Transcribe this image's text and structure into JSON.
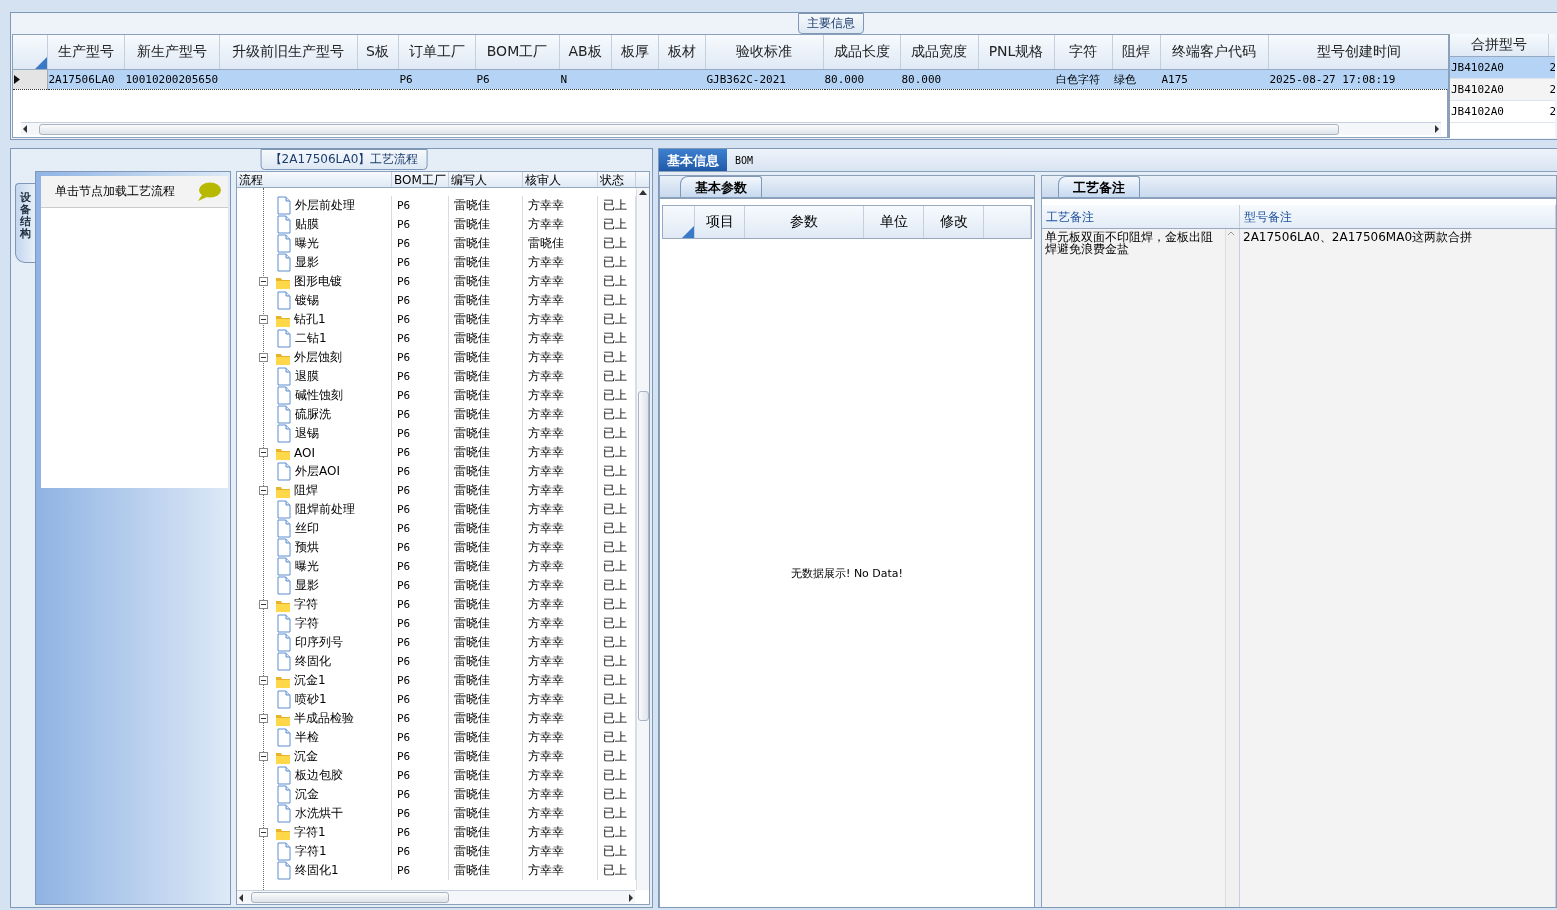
{
  "main_info": {
    "title": "主要信息",
    "columns": [
      "生产型号",
      "新生产型号",
      "升级前旧生产型号",
      "S板",
      "订单工厂",
      "BOM工厂",
      "AB板",
      "板厚",
      "板材",
      "验收标准",
      "成品长度",
      "成品宽度",
      "PNL规格",
      "字符",
      "阻焊",
      "终端客户代码",
      "型号创建时间"
    ],
    "rows": [
      {
        "selected": true,
        "cells": [
          "2A17506LA0",
          "10010200205650",
          null,
          null,
          "P6",
          "P6",
          "N",
          null,
          null,
          "GJB362C-2021",
          "80.000",
          "80.000",
          null,
          "白色字符",
          "绿色",
          "A175",
          "2025-08-27 17:08:19"
        ]
      }
    ]
  },
  "merge_models": {
    "columns": [
      "合拼型号"
    ],
    "rows": [
      {
        "selected": true,
        "cells": [
          "JB4102A0",
          "2"
        ]
      },
      {
        "selected": false,
        "cells": [
          "JB4102A0",
          "2"
        ]
      },
      {
        "selected": false,
        "cells": [
          "JB4102A0",
          "2"
        ]
      }
    ]
  },
  "flow": {
    "title": "【2A17506LA0】工艺流程",
    "side_tab": "设备结构",
    "hint": "单击节点加载工艺流程",
    "columns": [
      "流程",
      "BOM工厂",
      "编写人",
      "核审人",
      "状态"
    ],
    "items": [
      {
        "kind": "step",
        "name": "外层前处理",
        "bom": "P6",
        "author": "雷晓佳",
        "reviewer": "方幸幸",
        "status": "已上"
      },
      {
        "kind": "step",
        "name": "贴膜",
        "bom": "P6",
        "author": "雷晓佳",
        "reviewer": "方幸幸",
        "status": "已上"
      },
      {
        "kind": "step",
        "name": "曝光",
        "bom": "P6",
        "author": "雷晓佳",
        "reviewer": "雷晓佳",
        "status": "已上"
      },
      {
        "kind": "step",
        "name": "显影",
        "bom": "P6",
        "author": "雷晓佳",
        "reviewer": "方幸幸",
        "status": "已上"
      },
      {
        "kind": "group",
        "name": "图形电镀",
        "bom": "P6",
        "author": "雷晓佳",
        "reviewer": "方幸幸",
        "status": "已上",
        "expanded": true,
        "children": [
          {
            "kind": "step",
            "name": "镀锡",
            "bom": "P6",
            "author": "雷晓佳",
            "reviewer": "方幸幸",
            "status": "已上"
          }
        ]
      },
      {
        "kind": "group",
        "name": "钻孔1",
        "bom": "P6",
        "author": "雷晓佳",
        "reviewer": "方幸幸",
        "status": "已上",
        "expanded": true,
        "children": [
          {
            "kind": "step",
            "name": "二钻1",
            "bom": "P6",
            "author": "雷晓佳",
            "reviewer": "方幸幸",
            "status": "已上"
          }
        ]
      },
      {
        "kind": "group",
        "name": "外层蚀刻",
        "bom": "P6",
        "author": "雷晓佳",
        "reviewer": "方幸幸",
        "status": "已上",
        "expanded": true,
        "children": [
          {
            "kind": "step",
            "name": "退膜",
            "bom": "P6",
            "author": "雷晓佳",
            "reviewer": "方幸幸",
            "status": "已上"
          },
          {
            "kind": "step",
            "name": "碱性蚀刻",
            "bom": "P6",
            "author": "雷晓佳",
            "reviewer": "方幸幸",
            "status": "已上"
          },
          {
            "kind": "step",
            "name": "硫脲洗",
            "bom": "P6",
            "author": "雷晓佳",
            "reviewer": "方幸幸",
            "status": "已上"
          },
          {
            "kind": "step",
            "name": "退锡",
            "bom": "P6",
            "author": "雷晓佳",
            "reviewer": "方幸幸",
            "status": "已上"
          }
        ]
      },
      {
        "kind": "group",
        "name": "AOI",
        "bom": "P6",
        "author": "雷晓佳",
        "reviewer": "方幸幸",
        "status": "已上",
        "expanded": true,
        "children": [
          {
            "kind": "step",
            "name": "外层AOI",
            "bom": "P6",
            "author": "雷晓佳",
            "reviewer": "方幸幸",
            "status": "已上"
          }
        ]
      },
      {
        "kind": "group",
        "name": "阻焊",
        "bom": "P6",
        "author": "雷晓佳",
        "reviewer": "方幸幸",
        "status": "已上",
        "expanded": true,
        "children": [
          {
            "kind": "step",
            "name": "阻焊前处理",
            "bom": "P6",
            "author": "雷晓佳",
            "reviewer": "方幸幸",
            "status": "已上"
          },
          {
            "kind": "step",
            "name": "丝印",
            "bom": "P6",
            "author": "雷晓佳",
            "reviewer": "方幸幸",
            "status": "已上"
          },
          {
            "kind": "step",
            "name": "预烘",
            "bom": "P6",
            "author": "雷晓佳",
            "reviewer": "方幸幸",
            "status": "已上"
          },
          {
            "kind": "step",
            "name": "曝光",
            "bom": "P6",
            "author": "雷晓佳",
            "reviewer": "方幸幸",
            "status": "已上"
          },
          {
            "kind": "step",
            "name": "显影",
            "bom": "P6",
            "author": "雷晓佳",
            "reviewer": "方幸幸",
            "status": "已上"
          }
        ]
      },
      {
        "kind": "group",
        "name": "字符",
        "bom": "P6",
        "author": "雷晓佳",
        "reviewer": "方幸幸",
        "status": "已上",
        "expanded": true,
        "children": [
          {
            "kind": "step",
            "name": "字符",
            "bom": "P6",
            "author": "雷晓佳",
            "reviewer": "方幸幸",
            "status": "已上"
          },
          {
            "kind": "step",
            "name": "印序列号",
            "bom": "P6",
            "author": "雷晓佳",
            "reviewer": "方幸幸",
            "status": "已上"
          },
          {
            "kind": "step",
            "name": "终固化",
            "bom": "P6",
            "author": "雷晓佳",
            "reviewer": "方幸幸",
            "status": "已上"
          }
        ]
      },
      {
        "kind": "group",
        "name": "沉金1",
        "bom": "P6",
        "author": "雷晓佳",
        "reviewer": "方幸幸",
        "status": "已上",
        "expanded": true,
        "children": [
          {
            "kind": "step",
            "name": "喷砂1",
            "bom": "P6",
            "author": "雷晓佳",
            "reviewer": "方幸幸",
            "status": "已上"
          }
        ]
      },
      {
        "kind": "group",
        "name": "半成品检验",
        "bom": "P6",
        "author": "雷晓佳",
        "reviewer": "方幸幸",
        "status": "已上",
        "expanded": true,
        "children": [
          {
            "kind": "step",
            "name": "半检",
            "bom": "P6",
            "author": "雷晓佳",
            "reviewer": "方幸幸",
            "status": "已上"
          }
        ]
      },
      {
        "kind": "group",
        "name": "沉金",
        "bom": "P6",
        "author": "雷晓佳",
        "reviewer": "方幸幸",
        "status": "已上",
        "expanded": true,
        "children": [
          {
            "kind": "step",
            "name": "板边包胶",
            "bom": "P6",
            "author": "雷晓佳",
            "reviewer": "方幸幸",
            "status": "已上"
          },
          {
            "kind": "step",
            "name": "沉金",
            "bom": "P6",
            "author": "雷晓佳",
            "reviewer": "方幸幸",
            "status": "已上"
          },
          {
            "kind": "step",
            "name": "水洗烘干",
            "bom": "P6",
            "author": "雷晓佳",
            "reviewer": "方幸幸",
            "status": "已上"
          }
        ]
      },
      {
        "kind": "group",
        "name": "字符1",
        "bom": "P6",
        "author": "雷晓佳",
        "reviewer": "方幸幸",
        "status": "已上",
        "expanded": true,
        "children": [
          {
            "kind": "step",
            "name": "字符1",
            "bom": "P6",
            "author": "雷晓佳",
            "reviewer": "方幸幸",
            "status": "已上"
          },
          {
            "kind": "step",
            "name": "终固化1",
            "bom": "P6",
            "author": "雷晓佳",
            "reviewer": "方幸幸",
            "status": "已上"
          }
        ]
      }
    ]
  },
  "detail": {
    "tabs": [
      {
        "label": "基本信息",
        "selected": true
      },
      {
        "label": "BOM",
        "selected": false
      }
    ],
    "params": {
      "tab": "基本参数",
      "columns": [
        "项目",
        "参数",
        "单位",
        "修改"
      ],
      "empty_message": "无数据展示! No Data!"
    },
    "notes": {
      "tab": "工艺备注",
      "columns": [
        "工艺备注",
        "型号备注"
      ],
      "rows": [
        {
          "cells": [
            "单元板双面不印阻焊，金板出阻焊避免浪费金盐",
            "2A17506LA0、2A17506MA0这两款合拼"
          ]
        }
      ]
    }
  }
}
